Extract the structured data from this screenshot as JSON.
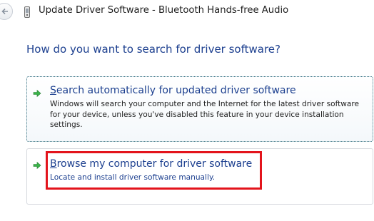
{
  "window": {
    "title": "Update Driver Software - Bluetooth Hands-free Audio"
  },
  "heading": "How do you want to search for driver software?",
  "options": [
    {
      "title_accel": "S",
      "title_rest": "earch automatically for updated driver software",
      "description": "Windows will search your computer and the Internet for the latest driver software for your device, unless you've disabled this feature in your device installation settings."
    },
    {
      "title_accel": "B",
      "title_rest": "rowse my computer for driver software",
      "description": "Locate and install driver software manually."
    }
  ],
  "icons": {
    "back": "back-arrow-icon",
    "device": "device-icon",
    "option_arrow": "green-arrow-icon"
  },
  "colors": {
    "heading": "#1c3f8f",
    "link": "#1c3f8f",
    "arrow": "#3bb54a",
    "highlight": "#e3141c"
  }
}
